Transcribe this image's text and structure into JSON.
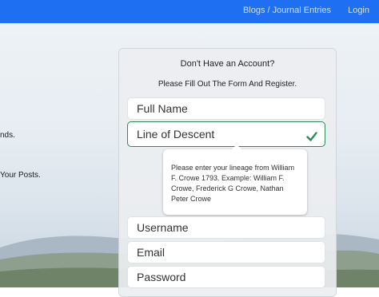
{
  "nav": {
    "blogs_label": "Blogs / Journal Entries",
    "login_label": "Login"
  },
  "left": {
    "text1": "nds.",
    "text2": "Your Posts."
  },
  "register": {
    "title": "Don't Have an Account?",
    "subtitle": "Please Fill Out The Form And Register.",
    "full_name_placeholder": "Full Name",
    "line_of_descent_placeholder": "Line of Descent",
    "tooltip_text": "Please enter your lineage from William F. Crowe 1793. Example: William F. Crowe, Frederick G Crowe, Nathan Peter Crowe",
    "username_placeholder": "Username",
    "email_placeholder": "Email",
    "password_placeholder": "Password"
  },
  "colors": {
    "nav_bg": "#1f6ff2",
    "valid_border": "#2e8b57",
    "check_color": "#2e8b57"
  },
  "icons": {
    "check": "check-icon"
  }
}
